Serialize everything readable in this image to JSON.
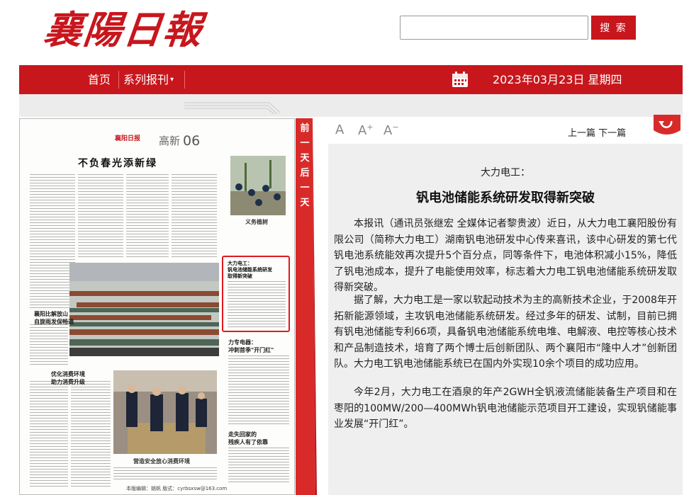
{
  "header": {
    "logo_text": "襄陽日報",
    "search_placeholder": "",
    "search_button": "搜 索"
  },
  "nav": {
    "home": "首页",
    "series": "系列报刊",
    "date": "2023年03月23日 星期四",
    "calendar_icon": "calendar-icon"
  },
  "newspaper": {
    "brand": "襄阳日报",
    "section": "高新",
    "page_number": "06",
    "headline": "不负春光添新绿",
    "photo1_caption": "义务植树",
    "sub_left1": "襄阳比解放山\n自旋雨发保畅通",
    "sub_left2": "优化消费环境\n助力消费升级",
    "sub_right1": "力专电器：\n冲刺首季\"开门红\"",
    "sub_right2": "走失回家的\n残疾人有了依靠",
    "photo3_caption": "营造安全放心消费环境",
    "highlight_title": "大力电工：\n钒电池储能系统研发\n取得新突破",
    "footer": "本版编辑：姚帆  版式：cyrbsxsw@163.com"
  },
  "tab": {
    "label": "前一天后一天"
  },
  "toolbar": {
    "font_default": "A",
    "font_increase": "A",
    "font_increase_mark": "+",
    "font_decrease": "A",
    "font_decrease_mark": "−",
    "prev_next": "上一篇 下一篇"
  },
  "article": {
    "kicker": "大力电工：",
    "title": "钒电池储能系统研发取得新突破",
    "paragraphs": [
      "本报讯（通讯员张继宏 全媒体记者黎贵波）近日，从大力电工襄阳股份有限公司（简称大力电工）湖南钒电池研发中心传来喜讯，该中心研发的第七代钒电池系统能效再次提升5个百分点，同等条件下，电池体积减小15%，降低了钒电池成本，提升了电能使用效率，标志着大力电工钒电池储能系统研发取得新突破。",
      "据了解，大力电工是一家以软起动技术为主的高新技术企业，于2008年开拓新能源领域，主攻钒电池储能系统研发。经过多年的研发、试制，目前已拥有钒电池储能专利66项，具备钒电池储能系统电堆、电解液、电控等核心技术和产品制造技术，培育了两个博士后创新团队、两个襄阳市“隆中人才”创新团队。大力电工钒电池储能系统已在国内外实现10余个项目的成功应用。",
      "今年2月，大力电工在酒泉的年产2GWH全钒液流储能装备生产项目和在枣阳的100MW/200—400MWh钒电池储能示范项目开工建设，实现钒储能事业发展“开门红”。"
    ]
  },
  "colors": {
    "brand_red": "#c8161d",
    "highlight": "#e0191f",
    "article_bg": "#efefef"
  }
}
